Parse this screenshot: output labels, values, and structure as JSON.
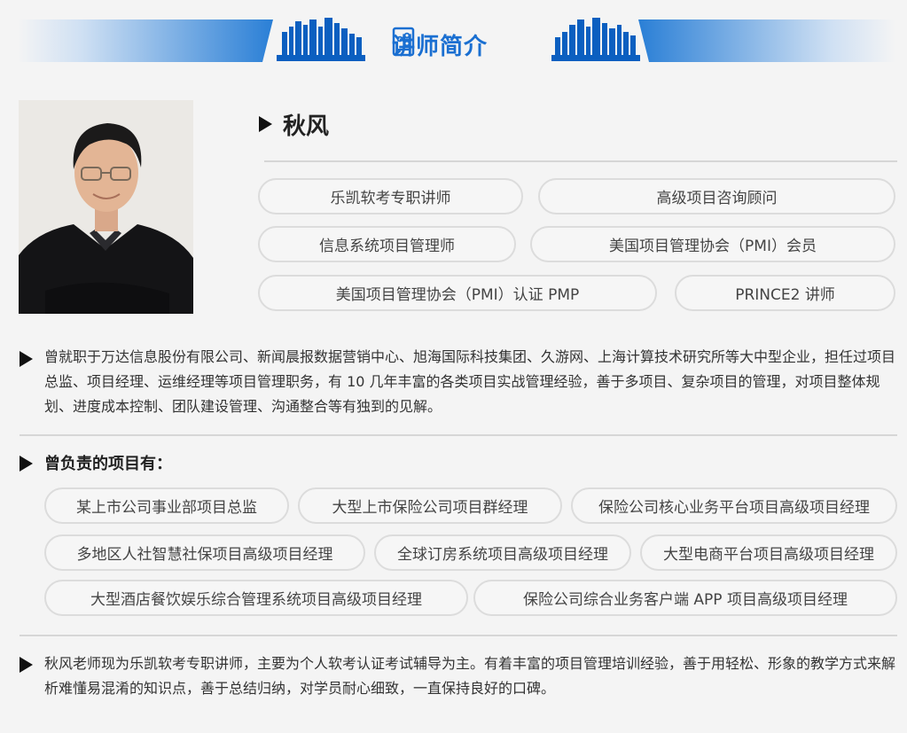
{
  "header": {
    "title": "讲师简介",
    "icon": "document-share-icon",
    "colors": {
      "primary": "#1a6fd1",
      "dark": "#0b4fa6"
    }
  },
  "profile": {
    "name": "秋风",
    "tags_row1": [
      "乐凯软考专职讲师",
      "高级项目咨询顾问"
    ],
    "tags_row2": [
      "信息系统项目管理师",
      "美国项目管理协会（PMI）会员"
    ],
    "tags_row3": [
      "美国项目管理协会（PMI）认证 PMP",
      "PRINCE2 讲师"
    ]
  },
  "experience": {
    "text": "曾就职于万达信息股份有限公司、新闻晨报数据营销中心、旭海国际科技集团、久游网、上海计算技术研究所等大中型企业，担任过项目总监、项目经理、运维经理等项目管理职务，有 10 几年丰富的各类项目实战管理经验，善于多项目、复杂项目的管理，对项目整体规划、进度成本控制、团队建设管理、沟通整合等有独到的见解。"
  },
  "projects": {
    "title": "曾负责的项目有：",
    "row1": [
      "某上市公司事业部项目总监",
      "大型上市保险公司项目群经理",
      "保险公司核心业务平台项目高级项目经理"
    ],
    "row2": [
      "多地区人社智慧社保项目高级项目经理",
      "全球订房系统项目高级项目经理",
      "大型电商平台项目高级项目经理"
    ],
    "row3": [
      "大型酒店餐饮娱乐综合管理系统项目高级项目经理",
      "保险公司综合业务客户端 APP 项目高级项目经理"
    ]
  },
  "summary": {
    "text": "秋风老师现为乐凯软考专职讲师，主要为个人软考认证考试辅导为主。有着丰富的项目管理培训经验，善于用轻松、形象的教学方式来解析难懂易混淆的知识点，善于总结归纳，对学员耐心细致，一直保持良好的口碑。"
  }
}
